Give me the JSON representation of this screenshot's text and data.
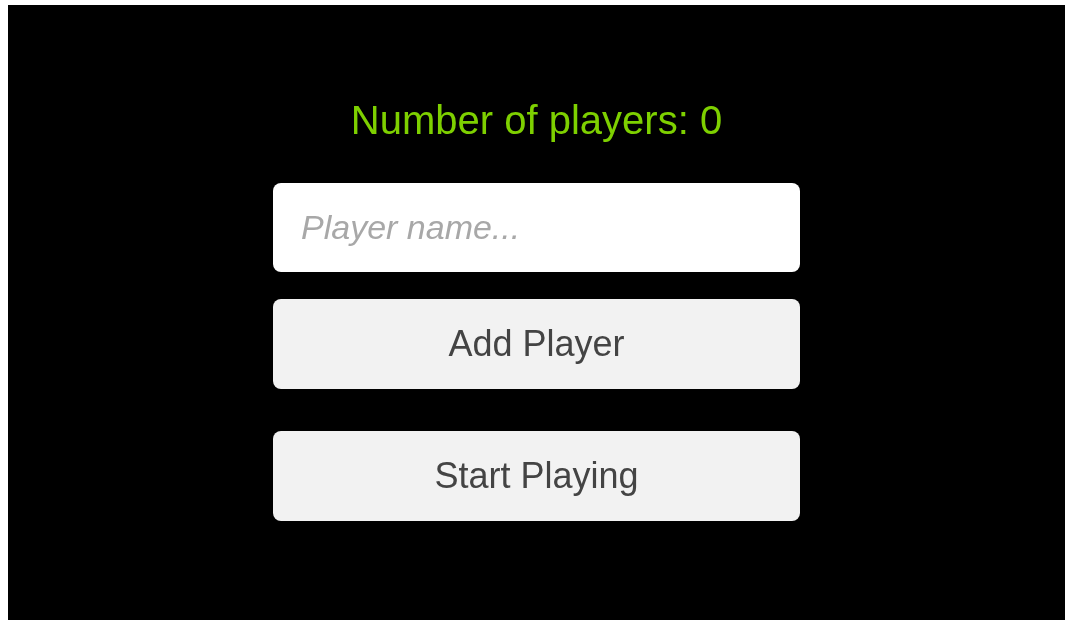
{
  "heading": "Number of players: 0",
  "name_field": {
    "placeholder": "Player name..."
  },
  "buttons": [
    {
      "label": "Add Player"
    },
    {
      "label": "Start Playing"
    }
  ]
}
